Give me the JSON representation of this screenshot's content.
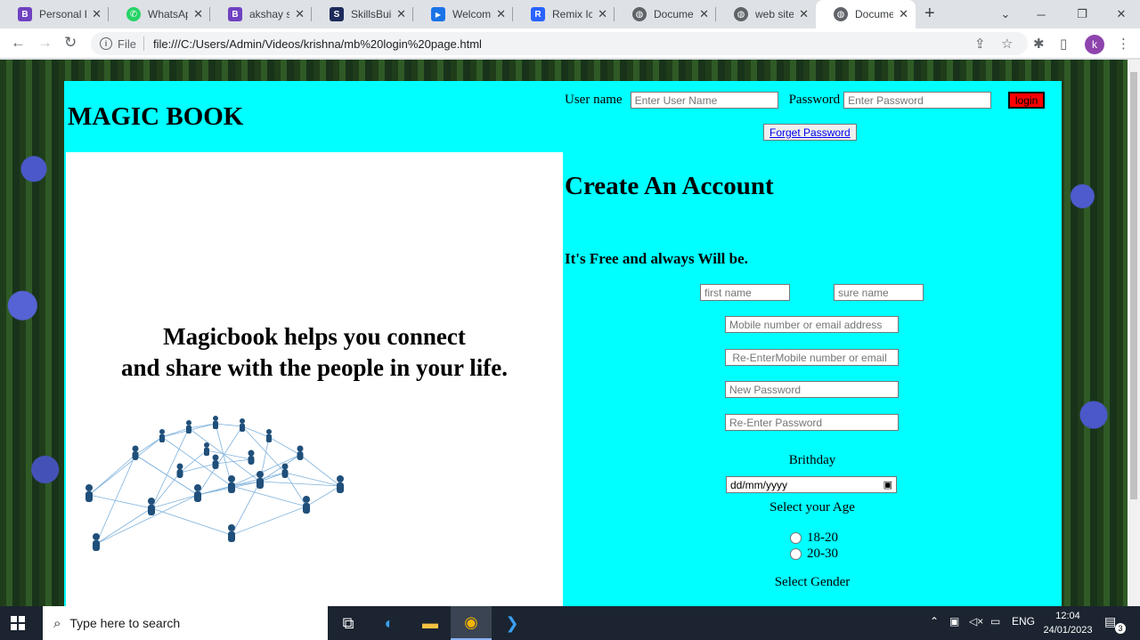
{
  "browser": {
    "tabs": [
      {
        "label": "Personal B",
        "icon": "bootstrap-icon",
        "color": "#6f42c1",
        "glyph": "B"
      },
      {
        "label": "WhatsApp",
        "icon": "whatsapp-icon",
        "color": "#25d366",
        "glyph": "✆"
      },
      {
        "label": "akshay sur",
        "icon": "bootstrap-icon",
        "color": "#6f42c1",
        "glyph": "B"
      },
      {
        "label": "SkillsBuild",
        "icon": "skillsbuild-icon",
        "color": "#1c2b5a",
        "glyph": "S"
      },
      {
        "label": "Welcome",
        "icon": "youtube-icon",
        "color": "#1a73e8",
        "glyph": "▶"
      },
      {
        "label": "Remix Icon",
        "icon": "remix-icon",
        "color": "#2962ff",
        "glyph": "R"
      },
      {
        "label": "Document",
        "icon": "globe-icon",
        "color": "#5f6368",
        "glyph": "◍"
      },
      {
        "label": "web site tu",
        "icon": "globe-icon",
        "color": "#5f6368",
        "glyph": "◍"
      },
      {
        "label": "Document",
        "icon": "globe-icon",
        "color": "#5f6368",
        "glyph": "◍"
      }
    ],
    "address": {
      "scheme_label": "File",
      "url": "file:///C:/Users/Admin/Videos/krishna/mb%20login%20page.html"
    },
    "profile_initial": "k"
  },
  "page": {
    "brand": "MAGIC BOOK",
    "login": {
      "username_label": "User name",
      "username_placeholder": "Enter User Name",
      "password_label": "Password",
      "password_placeholder": "Enter Password",
      "login_button": "login",
      "forget_button": "Forget Password"
    },
    "tagline_line1": "Magicbook helps you connect",
    "tagline_line2": "and share with the people in your life.",
    "signup": {
      "title": "Create An Account",
      "subtitle": "It's Free and always Will be.",
      "first_name_placeholder": "first name",
      "surname_placeholder": "sure name",
      "mobile_placeholder": "Mobile number or email address",
      "re_mobile_placeholder": " Re-EnterMobile number or email",
      "new_password_placeholder": "New Password",
      "re_password_placeholder": "Re-Enter Password",
      "birthday_label": "Brithday",
      "date_placeholder": "dd/mm/yyyy",
      "age_label": "Select your Age",
      "age_options": [
        "18-20",
        "20-30"
      ],
      "gender_label": "Select Gender"
    }
  },
  "taskbar": {
    "search_placeholder": "Type here to search",
    "language": "ENG",
    "time": "12:04",
    "date": "24/01/2023",
    "notification_count": "3"
  }
}
